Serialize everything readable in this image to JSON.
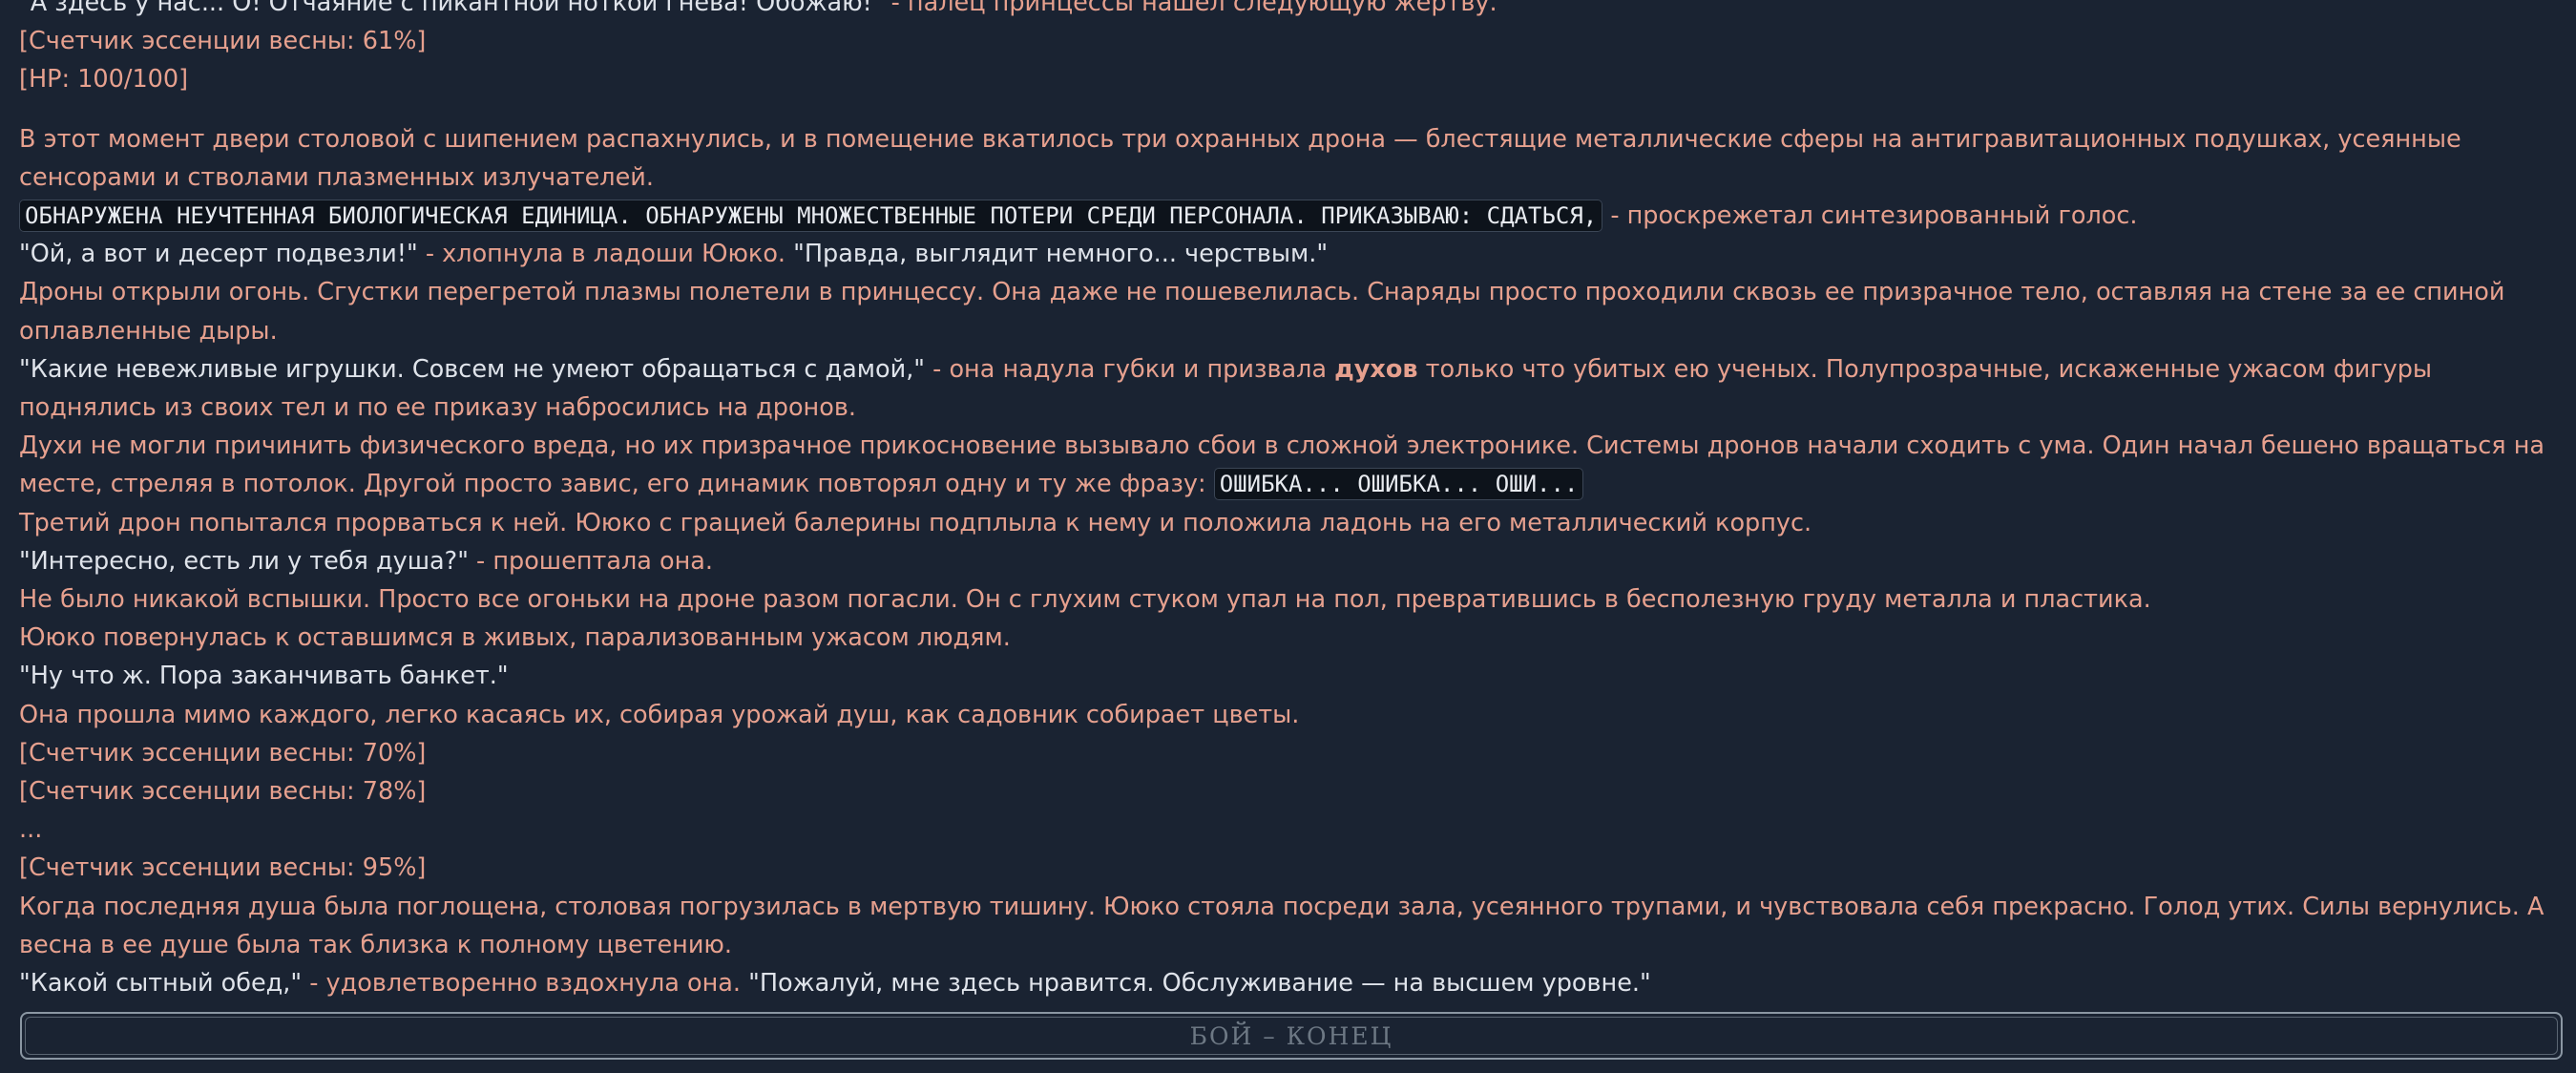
{
  "story": {
    "lines": [
      [
        {
          "t": "\"А здесь у нас... О! Отчаяние с пикантной ноткой гнева! Обожаю!\"",
          "c": "white"
        },
        {
          "t": " - палец принцессы нашел следующую жертву.",
          "c": "salmon"
        }
      ],
      [
        {
          "t": "[Счетчик эссенции весны: 61%]",
          "c": "salmon"
        }
      ],
      [
        {
          "t": "[HP: 100/100]",
          "c": "salmon"
        }
      ],
      [
        {
          "t": "В этот момент двери столовой с шипением распахнулись, и в помещение вкатилось три охранных дрона — блестящие металлические сферы на антигравитационных подушках, усеянные сенсорами и стволами плазменных излучателей.",
          "c": "salmon"
        }
      ],
      [
        {
          "t": "ОБНАРУЖЕНА НЕУЧТЕННАЯ БИОЛОГИЧЕСКАЯ ЕДИНИЦА. ОБНАРУЖЕНЫ МНОЖЕСТВЕННЫЕ ПОТЕРИ СРЕДИ ПЕРСОНАЛА. ПРИКАЗЫВАЮ: СДАТЬСЯ,",
          "c": "code"
        },
        {
          "t": " - проскрежетал синтезированный голос.",
          "c": "salmon"
        }
      ],
      [
        {
          "t": "\"Ой, а вот и десерт подвезли!\"",
          "c": "white"
        },
        {
          "t": " - хлопнула в ладоши Ююко. ",
          "c": "salmon"
        },
        {
          "t": "\"Правда, выглядит немного... черствым.\"",
          "c": "white"
        }
      ],
      [
        {
          "t": "Дроны открыли огонь. Сгустки перегретой плазмы полетели в принцессу. Она даже не пошевелилась. Снаряды просто проходили сквозь ее призрачное тело, оставляя на стене за ее спиной оплавленные дыры.",
          "c": "salmon"
        }
      ],
      [
        {
          "t": "\"Какие невежливые игрушки. Совсем не умеют обращаться с дамой,\"",
          "c": "white"
        },
        {
          "t": " - она надула губки и призвала ",
          "c": "salmon"
        },
        {
          "t": "духов",
          "c": "salmon bold"
        },
        {
          "t": " только что убитых ею ученых. Полупрозрачные, искаженные ужасом фигуры поднялись из своих тел и по ее приказу набросились на дронов.",
          "c": "salmon"
        }
      ],
      [
        {
          "t": "Духи не могли причинить физического вреда, но их призрачное прикосновение вызывало сбои в сложной электронике. Системы дронов начали сходить с ума. Один начал бешено вращаться на месте, стреляя в потолок. Другой просто завис, его динамик повторял одну и ту же фразу: ",
          "c": "salmon"
        },
        {
          "t": "ОШИБКА... ОШИБКА... ОШИ...",
          "c": "code"
        }
      ],
      [
        {
          "t": "Третий дрон попытался прорваться к ней. Ююко с грацией балерины подплыла к нему и положила ладонь на его металлический корпус.",
          "c": "salmon"
        }
      ],
      [
        {
          "t": "\"Интересно, есть ли у тебя душа?\"",
          "c": "white"
        },
        {
          "t": " - прошептала она.",
          "c": "salmon"
        }
      ],
      [
        {
          "t": "Не было никакой вспышки. Просто все огоньки на дроне разом погасли. Он с глухим стуком упал на пол, превратившись в бесполезную груду металла и пластика.",
          "c": "salmon"
        }
      ],
      [
        {
          "t": "Ююко повернулась к оставшимся в живых, парализованным ужасом людям.",
          "c": "salmon"
        }
      ],
      [
        {
          "t": "\"Ну что ж. Пора заканчивать банкет.\"",
          "c": "white"
        }
      ],
      [
        {
          "t": "Она прошла мимо каждого, легко касаясь их, собирая урожай душ, как садовник собирает цветы.",
          "c": "salmon"
        }
      ],
      [
        {
          "t": "[Счетчик эссенции весны: 70%]",
          "c": "salmon"
        }
      ],
      [
        {
          "t": "[Счетчик эссенции весны: 78%]",
          "c": "salmon"
        }
      ],
      [
        {
          "t": "...",
          "c": "salmon"
        }
      ],
      [
        {
          "t": "[Счетчик эссенции весны: 95%]",
          "c": "salmon"
        }
      ],
      [
        {
          "t": "Когда последняя душа была поглощена, столовая погрузилась в мертвую тишину. Ююко стояла посреди зала, усеянного трупами, и чувствовала себя прекрасно. Голод утих. Силы вернулись. А весна в ее душе была так близка к полному цветению.",
          "c": "salmon"
        }
      ],
      [
        {
          "t": "\"Какой сытный обед,\"",
          "c": "white"
        },
        {
          "t": " - удовлетворенно вздохнула она. ",
          "c": "salmon"
        },
        {
          "t": "\"Пожалуй, мне здесь нравится. Обслуживание — на высшем уровне.\"",
          "c": "white"
        }
      ]
    ]
  },
  "footer": {
    "end_label": "БОЙ – КОНЕЦ"
  },
  "colors": {
    "background": "#1a2332",
    "narration": "#e6a08e",
    "dialogue": "#dfe3ea",
    "code_bg": "#0d131b"
  }
}
